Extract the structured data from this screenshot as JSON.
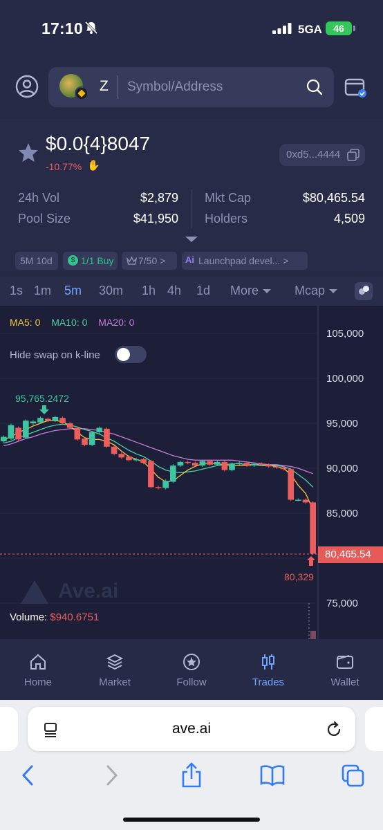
{
  "status_bar": {
    "time": "17:10",
    "network": "5GA",
    "battery": "46"
  },
  "header": {
    "account": "Z",
    "search_placeholder": "Symbol/Address"
  },
  "token": {
    "price": "$0.0{4}8047",
    "change": "-10.77%",
    "address": "0xd5...4444",
    "stats": [
      {
        "label": "24h Vol",
        "value": "$2,879"
      },
      {
        "label": "Pool Size",
        "value": "$41,950"
      },
      {
        "label": "Mkt Cap",
        "value": "$80,465.54"
      },
      {
        "label": "Holders",
        "value": "4,509"
      }
    ],
    "tags": [
      "5M 10d",
      "1/1 Buy",
      "7/50 >",
      "Launchpad devel... >"
    ]
  },
  "timeframes": [
    "1s",
    "1m",
    "5m",
    "30m",
    "1h",
    "4h",
    "1d",
    "More",
    "Mcap"
  ],
  "active_timeframe": "5m",
  "chart": {
    "ma_labels": [
      "MA5: 0",
      "MA10: 0",
      "MA20: 0"
    ],
    "hide_swap_label": "Hide swap on k-line",
    "hide_swap_on": false,
    "watermark": "Ave.ai",
    "volume_label": "Volume:",
    "volume_value": "$940.6751",
    "current_price_label": "80,465.54",
    "low_label": "80,329",
    "high_label": "95,765.2472",
    "colors": {
      "up": "#3ec6a2",
      "down": "#ec5d5d",
      "ma5": "#f5c542",
      "ma10": "#4fd1a6",
      "ma20": "#c77ddc"
    }
  },
  "chart_data": {
    "type": "candlestick",
    "y_ticks": [
      "105,000",
      "100,000",
      "95,000",
      "90,000",
      "85,000",
      "75,000"
    ],
    "ylim": [
      71000,
      107000
    ],
    "candles": [
      {
        "o": 93000,
        "c": 93500
      },
      {
        "o": 93300,
        "c": 94800
      },
      {
        "o": 94500,
        "c": 93200
      },
      {
        "o": 93400,
        "c": 95300
      },
      {
        "o": 95000,
        "c": 95200
      },
      {
        "o": 95100,
        "c": 95600
      },
      {
        "o": 95500,
        "c": 95300
      },
      {
        "o": 95300,
        "c": 95700
      },
      {
        "o": 95600,
        "c": 95000
      },
      {
        "o": 95000,
        "c": 94500
      },
      {
        "o": 94500,
        "c": 93200
      },
      {
        "o": 93300,
        "c": 92600
      },
      {
        "o": 92600,
        "c": 94000
      },
      {
        "o": 94000,
        "c": 94500
      },
      {
        "o": 94400,
        "c": 92400
      },
      {
        "o": 92400,
        "c": 91600
      },
      {
        "o": 91600,
        "c": 91200
      },
      {
        "o": 91300,
        "c": 90900
      },
      {
        "o": 90900,
        "c": 91000
      },
      {
        "o": 91000,
        "c": 90600
      },
      {
        "o": 90800,
        "c": 87900
      },
      {
        "o": 87900,
        "c": 87800
      },
      {
        "o": 87800,
        "c": 88600
      },
      {
        "o": 88500,
        "c": 90300
      },
      {
        "o": 90300,
        "c": 90700
      },
      {
        "o": 90700,
        "c": 90600
      },
      {
        "o": 90600,
        "c": 90300
      },
      {
        "o": 90300,
        "c": 90800
      },
      {
        "o": 90800,
        "c": 90400
      },
      {
        "o": 90400,
        "c": 90700
      },
      {
        "o": 90700,
        "c": 89800
      },
      {
        "o": 89800,
        "c": 90500
      },
      {
        "o": 90500,
        "c": 90600
      },
      {
        "o": 90600,
        "c": 90300
      },
      {
        "o": 90300,
        "c": 90500
      },
      {
        "o": 90500,
        "c": 90400
      },
      {
        "o": 90400,
        "c": 90200
      },
      {
        "o": 90200,
        "c": 90100
      },
      {
        "o": 90100,
        "c": 89900
      },
      {
        "o": 89900,
        "c": 86500
      },
      {
        "o": 86500,
        "c": 86500
      },
      {
        "o": 86500,
        "c": 86200
      },
      {
        "o": 86200,
        "c": 80500
      }
    ],
    "ma5": [
      93200,
      93500,
      94000,
      94300,
      94700,
      95000,
      95300,
      95300,
      95200,
      94700,
      94000,
      93400,
      93200,
      93200,
      93000,
      92600,
      91900,
      91300,
      91000,
      90700,
      89900,
      89000,
      88500,
      88600,
      89200,
      89800,
      90200,
      90500,
      90600,
      90500,
      90400,
      90300,
      90300,
      90300,
      90400,
      90400,
      90300,
      90200,
      90000,
      89300,
      88100,
      87200,
      85400
    ],
    "ma10": [
      92800,
      93000,
      93400,
      93700,
      94000,
      94300,
      94600,
      94800,
      94900,
      94800,
      94600,
      94300,
      94100,
      93800,
      93400,
      93000,
      92500,
      92000,
      91600,
      91300,
      90800,
      90200,
      89800,
      89600,
      89500,
      89600,
      89700,
      89900,
      90100,
      90300,
      90400,
      90500,
      90500,
      90400,
      90400,
      90300,
      90300,
      90300,
      90200,
      89900,
      89300,
      88700,
      87900
    ],
    "ma20": [
      92500,
      92700,
      93000,
      93300,
      93500,
      93800,
      94000,
      94200,
      94300,
      94400,
      94400,
      94400,
      94300,
      94200,
      94000,
      93800,
      93500,
      93200,
      92900,
      92600,
      92300,
      92000,
      91700,
      91400,
      91200,
      91000,
      90900,
      90900,
      90900,
      90900,
      90900,
      90900,
      90800,
      90700,
      90600,
      90500,
      90400,
      90400,
      90300,
      90200,
      90000,
      89700,
      89400
    ]
  },
  "nav": [
    {
      "label": "Home",
      "icon": "home-icon"
    },
    {
      "label": "Market",
      "icon": "layers-icon"
    },
    {
      "label": "Follow",
      "icon": "star-circle-icon"
    },
    {
      "label": "Trades",
      "icon": "candles-icon"
    },
    {
      "label": "Wallet",
      "icon": "wallet-icon"
    }
  ],
  "active_nav": "Trades",
  "browser": {
    "host": "ave.ai"
  }
}
